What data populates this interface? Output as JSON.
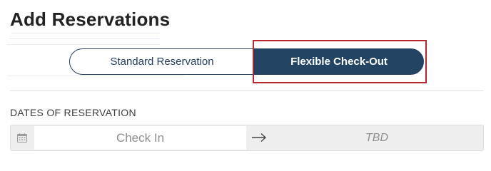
{
  "page": {
    "title": "Add Reservations"
  },
  "reservation_type": {
    "options": [
      {
        "label": "Standard Reservation",
        "selected": false
      },
      {
        "label": "Flexible Check-Out",
        "selected": true
      }
    ]
  },
  "dates": {
    "section_label": "DATES OF RESERVATION",
    "check_in_placeholder": "Check In",
    "check_out_value": "TBD"
  },
  "icons": {
    "calendar": "calendar-icon",
    "arrow": "arrow-right-icon"
  },
  "colors": {
    "primary": "#234463",
    "highlight": "#b5262e"
  }
}
